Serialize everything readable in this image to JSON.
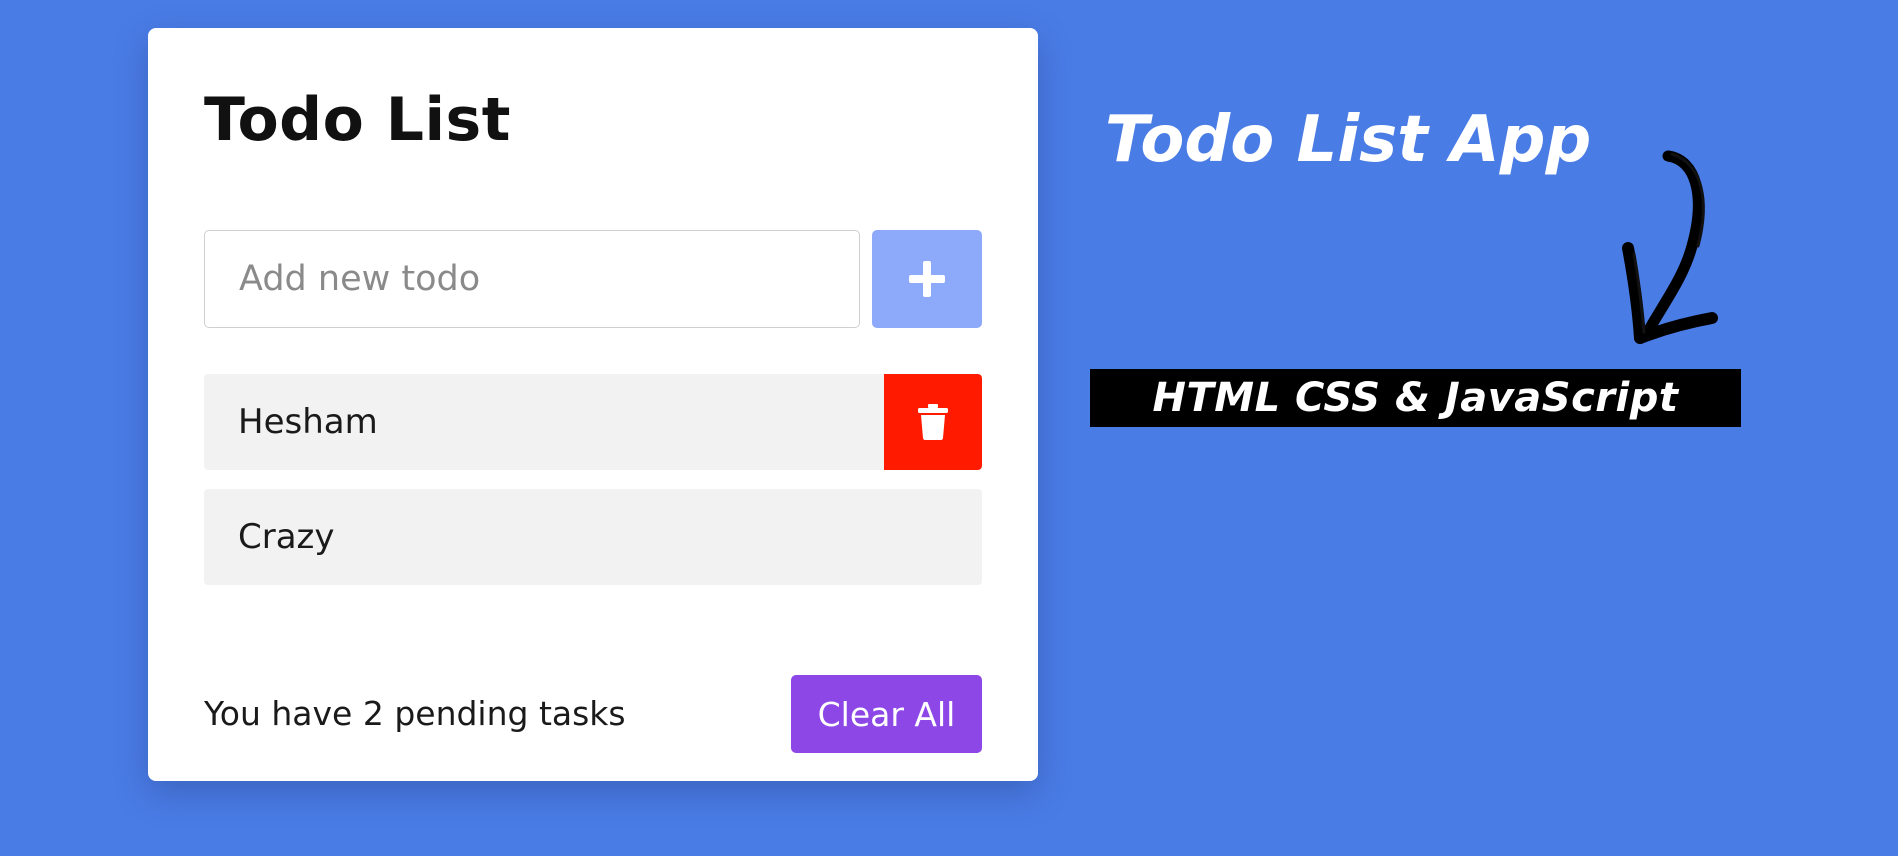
{
  "todo_app": {
    "title": "Todo List",
    "input": {
      "placeholder": "Add new todo",
      "value": ""
    },
    "add_button_icon": "plus-icon",
    "items": [
      {
        "text": "Hesham",
        "delete_icon": "trash-icon",
        "delete_visible": true
      },
      {
        "text": "Crazy",
        "delete_visible": false
      }
    ],
    "pending_text": "You have 2 pending tasks",
    "clear_button_label": "Clear All"
  },
  "promo": {
    "title": "Todo List App",
    "subtitle": "HTML CSS & JavaScript",
    "arrow_icon": "curved-arrow-down-icon"
  },
  "colors": {
    "background": "#4a7ce6",
    "card": "#ffffff",
    "add_button": "#8ca9fa",
    "delete_button": "#ff1a00",
    "clear_button": "#8d47e6",
    "todo_item_bg": "#f2f2f2",
    "banner_bg": "#000000"
  }
}
